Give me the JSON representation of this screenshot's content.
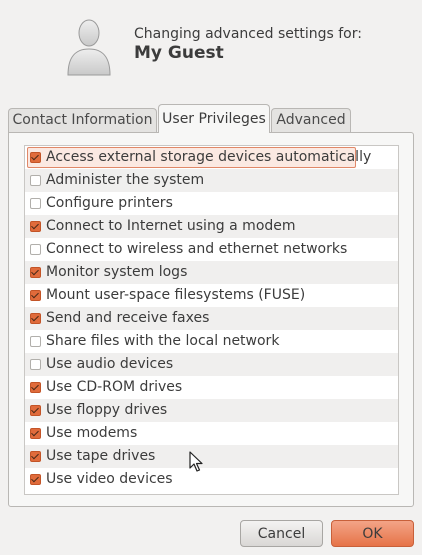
{
  "header": {
    "subtitle": "Changing advanced settings for:",
    "username": "My Guest",
    "avatar_icon": "user-silhouette-icon"
  },
  "tabs": [
    {
      "label": "Contact Information",
      "active": false
    },
    {
      "label": "User Privileges",
      "active": true
    },
    {
      "label": "Advanced",
      "active": false
    }
  ],
  "privileges": [
    {
      "label": "Access external storage devices automatically",
      "checked": true,
      "selected": true
    },
    {
      "label": "Administer the system",
      "checked": false
    },
    {
      "label": "Configure printers",
      "checked": false
    },
    {
      "label": "Connect to Internet using a modem",
      "checked": true
    },
    {
      "label": "Connect to wireless and ethernet networks",
      "checked": false
    },
    {
      "label": "Monitor system logs",
      "checked": true
    },
    {
      "label": "Mount user-space filesystems (FUSE)",
      "checked": true
    },
    {
      "label": "Send and receive faxes",
      "checked": true
    },
    {
      "label": "Share files with the local network",
      "checked": false
    },
    {
      "label": "Use audio devices",
      "checked": false
    },
    {
      "label": "Use CD-ROM drives",
      "checked": true
    },
    {
      "label": "Use floppy drives",
      "checked": true
    },
    {
      "label": "Use modems",
      "checked": true
    },
    {
      "label": "Use tape drives",
      "checked": true
    },
    {
      "label": "Use video devices",
      "checked": true
    }
  ],
  "buttons": {
    "cancel_label": "Cancel",
    "ok_label": "OK"
  },
  "colors": {
    "accent": "#e06b3b",
    "ok_button": "#e67348",
    "window_bg": "#f2f1f0"
  }
}
